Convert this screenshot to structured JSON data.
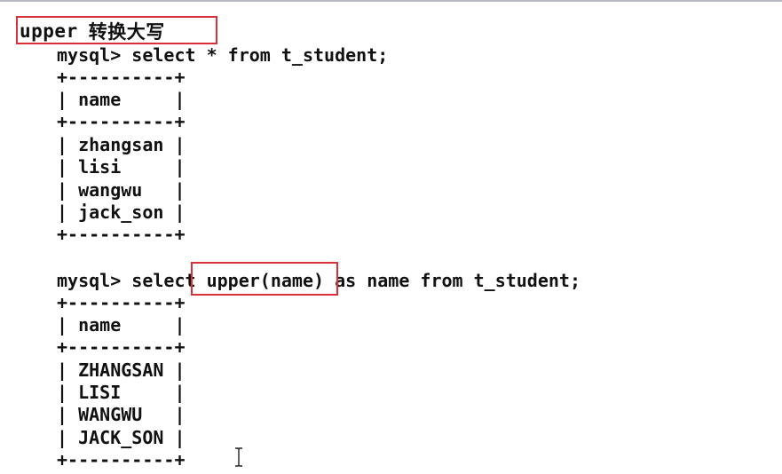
{
  "heading": {
    "code": "upper",
    "caption": "转换大写"
  },
  "query1": {
    "prompt": "mysql> select * from t_student;",
    "border": "+----------+",
    "header": "| name     |",
    "rows": [
      "| zhangsan |",
      "| lisi     |",
      "| wangwu   |",
      "| jack_son |"
    ]
  },
  "query2": {
    "prompt_before": "mysql> select ",
    "prompt_highlight": "upper(name)",
    "prompt_after": " as name from t_student;",
    "border": "+----------+",
    "header": "| name     |",
    "rows": [
      "| ZHANGSAN |",
      "| LISI     |",
      "| WANGWU   |",
      "| JACK_SON |"
    ]
  },
  "colors": {
    "highlight_border": "#d9303a",
    "text": "#111111",
    "background": "#ffffff"
  },
  "icons": {
    "cursor": "text-cursor-icon"
  }
}
